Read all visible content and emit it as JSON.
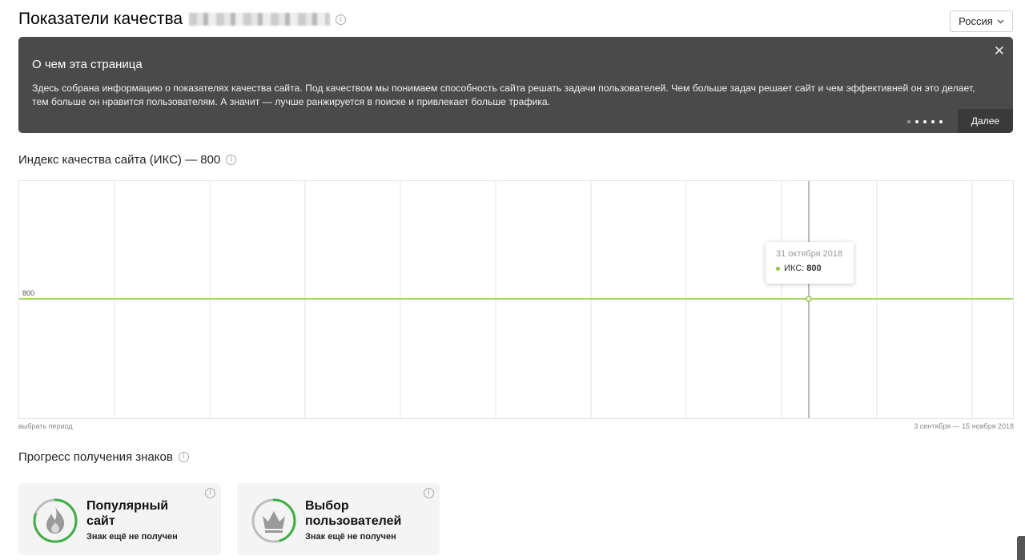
{
  "header": {
    "title": "Показатели качества",
    "region": "Россия"
  },
  "banner": {
    "title": "О чем эта страница",
    "text": "Здесь собрана информацию о показателях качества сайта. Под качеством мы понимаем способность сайта решать задачи пользователей. Чем больше задач решает сайт и чем эффективней он это делает, тем больше он нравится пользователям. А значит — лучше ранжируется в поиске и привлекает больше трафика.",
    "next_label": "Далее",
    "close_glyph": "✕",
    "pages_total": 5,
    "page_current": 1
  },
  "iks": {
    "title": "Индекс качества сайта (ИКС) — 800",
    "period_link": "выбрать период",
    "date_range": "3 сентября — 15 ноября 2018",
    "tooltip": {
      "date": "31 октября 2018",
      "series": "ИКС:",
      "value": "800"
    }
  },
  "chart_data": {
    "type": "line",
    "series": [
      {
        "name": "ИКС",
        "values": [
          800,
          800
        ]
      }
    ],
    "x": [
      "3 сентября 2018",
      "15 ноября 2018"
    ],
    "y_tick_label": "800",
    "line_color": "#8cc63f",
    "highlight_x": "31 октября 2018",
    "grid": true
  },
  "progress": {
    "title": "Прогресс получения знаков",
    "badges": [
      {
        "name_line1": "Популярный",
        "name_line2": "сайт",
        "status": "Знак ещё не получен",
        "icon": "flame-icon",
        "progress": 0.8
      },
      {
        "name_line1": "Выбор",
        "name_line2": "пользователей",
        "status": "Знак ещё не получен",
        "icon": "crown-icon",
        "progress": 0.45
      }
    ]
  },
  "colors": {
    "banner_bg": "#4a4a4a",
    "accent_green": "#8cc63f",
    "ring_green": "#3cb043"
  }
}
